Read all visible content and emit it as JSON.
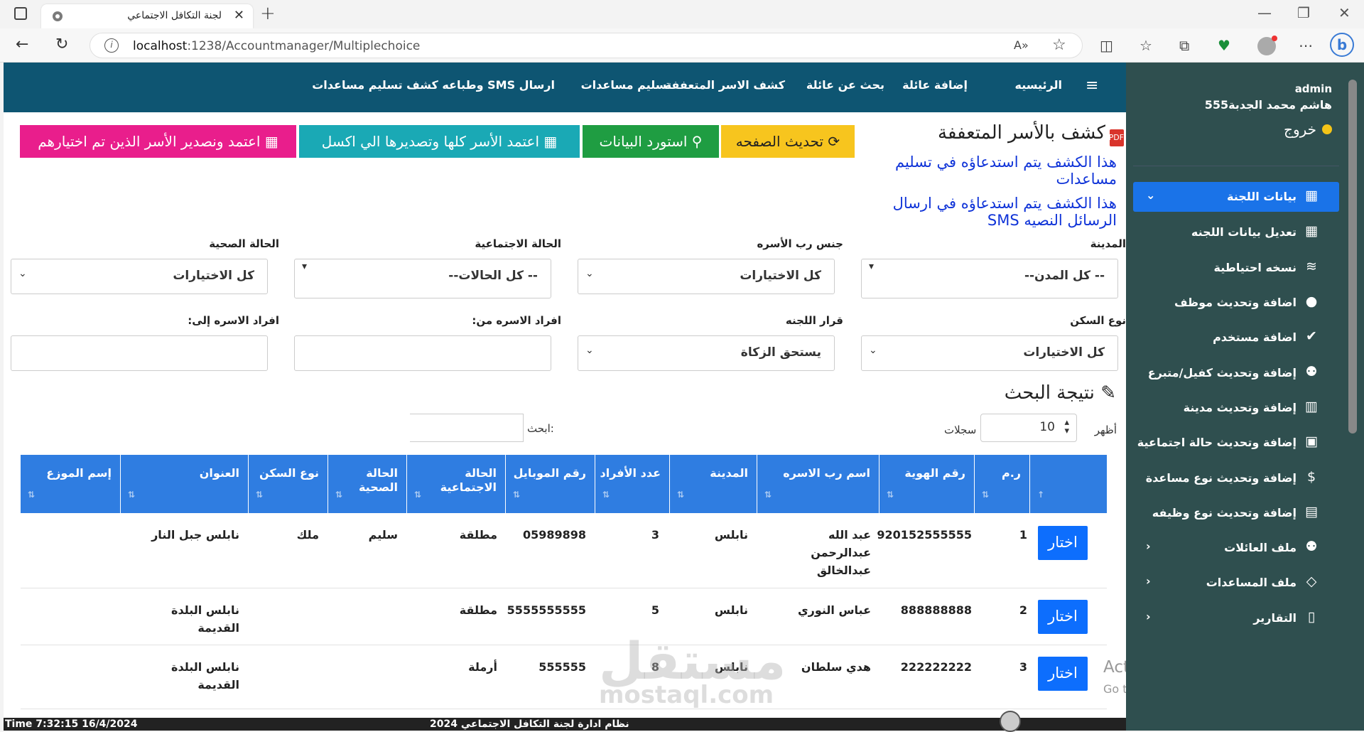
{
  "browser": {
    "tab_title": "لجنة التكافل الاجتماعي",
    "url_host": "localhost",
    "url_path": ":1238/Accountmanager/Multiplechoice"
  },
  "topnav": {
    "items": [
      "الرئيسيه",
      "إضافة عائلة",
      "بحث عن عائلة",
      "كشف الاسر المتعففة",
      "تسليم مساعدات",
      "ارسال SMS وطباعه كشف تسليم مساعدات"
    ]
  },
  "page": {
    "title": "كشف بالأسر المتعففة",
    "note1": "هذا الكشف يتم استدعاؤه في تسليم مساعدات",
    "note2": "هذا الكشف يتم استدعاؤه في ارسال الرسائل النصيه SMS",
    "buttons": {
      "refresh": "تحديث الصفحه",
      "import": "استورد البيانات",
      "approve_all": "اعتمد الأسر كلها وتصديرها الي اكسل",
      "approve_selected": "اعتمد ونصدير الأسر الذين تم اختيارهم"
    }
  },
  "filters": {
    "city_label": "المدينة",
    "city_value": "-- كل المدن--",
    "gender_label": "جنس رب الأسره",
    "gender_value": "كل الاختيارات",
    "social_label": "الحالة الاجتماعية",
    "social_value": "-- كل الحالات--",
    "health_label": "الحالة الصحية",
    "health_value": "كل الاختيارات",
    "housing_label": "نوع السكن",
    "housing_value": "كل الاختيارات",
    "decision_label": "قرار اللجنه",
    "decision_value": "يستحق الزكاة",
    "from_label": "افراد الاسره من:",
    "to_label": "افراد الاسره إلى:"
  },
  "results": {
    "title": "نتيجة البحث",
    "show_label": "أظهر",
    "show_value": "10",
    "records_label": "سجلات",
    "search_label": "ابحث:",
    "headers": [
      "",
      "ر.م",
      "رقم الهوية",
      "اسم رب الاسره",
      "المدينة",
      "عدد الأفراد",
      "رقم الموبايل",
      "الحالة الاجتماعية",
      "الحالة الصحية",
      "نوع السكن",
      "العنوان",
      "إسم الموزع"
    ],
    "pick_label": "اختار",
    "rows": [
      {
        "no": "1",
        "id": "920152555555",
        "name": "عبد الله عبدالرحمن عبدالخالق",
        "city": "نابلس",
        "count": "3",
        "mobile": "05989898",
        "social": "مطلقة",
        "health": "سليم",
        "housing": "ملك",
        "address": "نابلس جبل النار",
        "distributor": ""
      },
      {
        "no": "2",
        "id": "888888888",
        "name": "عباس النوري",
        "city": "نابلس",
        "count": "5",
        "mobile": "5555555555",
        "social": "مطلقة",
        "health": "",
        "housing": "",
        "address": "نابلس البلدة القديمة",
        "distributor": ""
      },
      {
        "no": "3",
        "id": "222222222",
        "name": "هدي سلطان",
        "city": "نابلس",
        "count": "8",
        "mobile": "555555",
        "social": "أرملة",
        "health": "",
        "housing": "",
        "address": "نابلس البلدة القديمة",
        "distributor": ""
      }
    ]
  },
  "status": {
    "time": "Time 7:32:15 16/4/2024",
    "system": "نظام ادارة لجنة التكافل الاجتماعي 2024"
  },
  "sidebar": {
    "user": "admin",
    "name": "هاشم محمد الجدبة555",
    "logout": "خروج",
    "items": [
      {
        "label": "بيانات اللجنة",
        "icon": "building-icon"
      },
      {
        "label": "تعديل بيانات اللجنه",
        "icon": "building-icon"
      },
      {
        "label": "نسخه احتياطية",
        "icon": "database-icon"
      },
      {
        "label": "اضافة وتحديث موظف",
        "icon": "user-icon"
      },
      {
        "label": "اضافة مستخدم",
        "icon": "user-check-icon"
      },
      {
        "label": "إضافة وتحديث كفيل/متبرع",
        "icon": "users-icon"
      },
      {
        "label": "إضافة وتحديث مدينة",
        "icon": "city-icon"
      },
      {
        "label": "إضافة وتحديث حالة اجتماعية",
        "icon": "id-card-icon"
      },
      {
        "label": "إضافة وتحديث نوع مساعدة",
        "icon": "dollar-icon"
      },
      {
        "label": "إضافة وتحديث نوع وظيفه",
        "icon": "badge-icon"
      },
      {
        "label": "ملف العائلات",
        "icon": "users-icon"
      },
      {
        "label": "ملف المساعدات",
        "icon": "diamond-icon"
      },
      {
        "label": "التقارير",
        "icon": "pdf-icon"
      }
    ]
  },
  "overlay": {
    "activate_title": "Activate Windows",
    "activate_sub": "Go to Settings to activate Windows.",
    "watermark": "مستقل",
    "watermark_url": "mostaql.com"
  }
}
